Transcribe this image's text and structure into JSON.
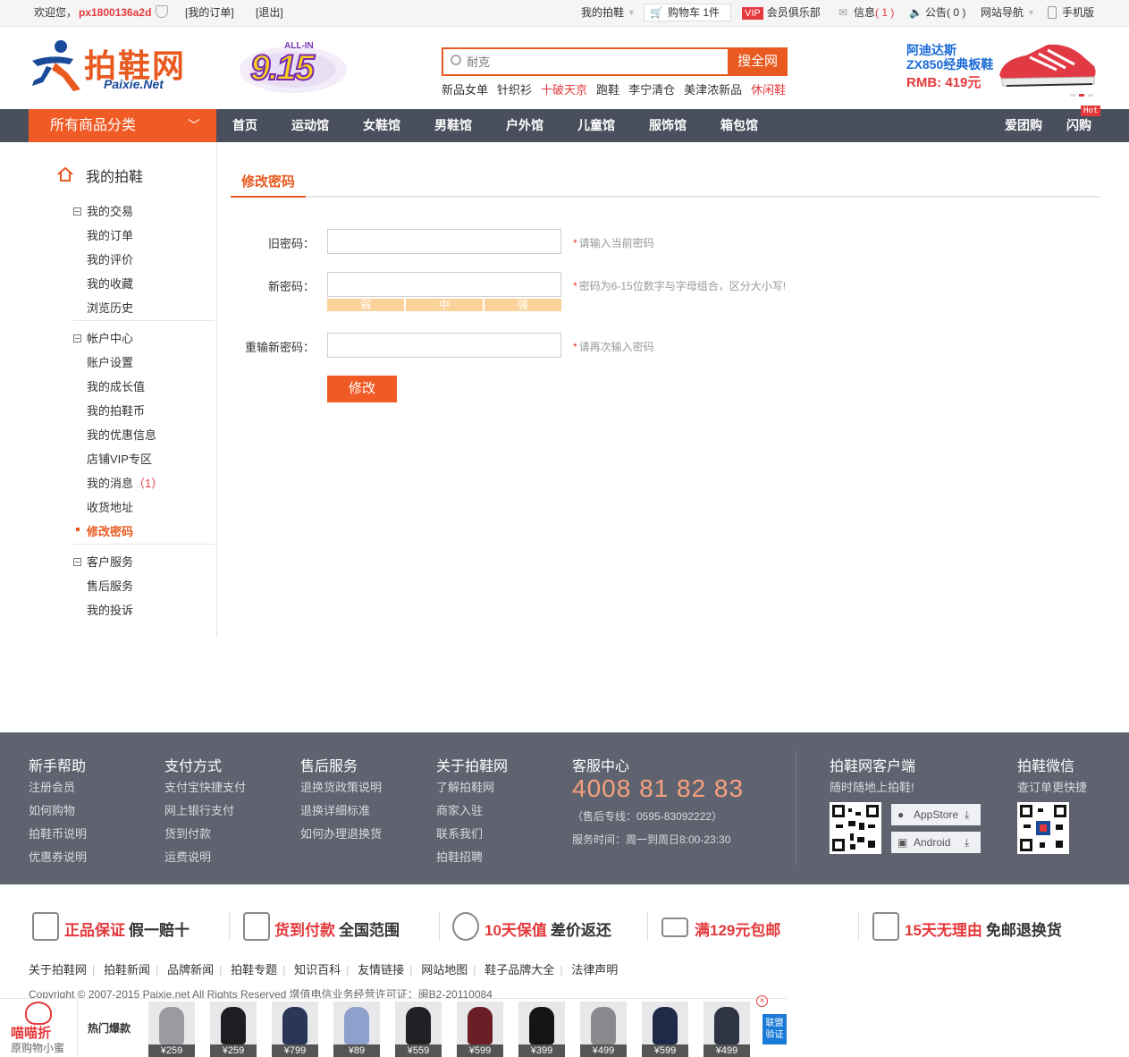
{
  "topbar": {
    "welcome": "欢迎您，",
    "username": "px1800136a2d",
    "my_orders": "[我的订单]",
    "logout": "[退出]",
    "my_paixie": "我的拍鞋",
    "cart": "购物车 1件",
    "vip_badge": "VIP",
    "club": "会员俱乐部",
    "messages_label": "信息",
    "messages_count": "( 1 )",
    "notice_label": "公告",
    "notice_count": "( 0 )",
    "site_nav": "网站导航",
    "mobile": "手机版"
  },
  "header": {
    "logo_text": "拍鞋网",
    "logo_sub": "Paixie.Net",
    "badge_top": "ALL-IN",
    "badge_main": "9.15",
    "search_placeholder": "耐克",
    "search_button": "搜全网",
    "hotwords": [
      "新品女单",
      "针织衫",
      "十破天京",
      "跑鞋",
      "李宁清仓",
      "美津浓新品",
      "休闲鞋"
    ],
    "ad_line1": "阿迪达斯",
    "ad_line2": "ZX850经典板鞋",
    "ad_price": "RMB: 419元"
  },
  "nav": {
    "all_categories": "所有商品分类",
    "items": [
      "首页",
      "运动馆",
      "女鞋馆",
      "男鞋馆",
      "户外馆",
      "儿童馆",
      "服饰馆",
      "箱包馆"
    ],
    "right_items": [
      "爱团购",
      "闪购"
    ],
    "hot_badge": "Hot"
  },
  "sidebar": {
    "title": "我的拍鞋",
    "groups": [
      {
        "label": "我的交易",
        "items": [
          "我的订单",
          "我的评价",
          "我的收藏",
          "浏览历史"
        ]
      },
      {
        "label": "帐户中心",
        "items": [
          "账户设置",
          "我的成长值",
          "我的拍鞋币",
          "我的优惠信息",
          "店铺VIP专区",
          "我的消息",
          "收货地址",
          "修改密码"
        ]
      },
      {
        "label": "客户服务",
        "items": [
          "售后服务",
          "我的投诉"
        ]
      }
    ],
    "message_count": "（1）"
  },
  "form": {
    "tab": "修改密码",
    "old_label": "旧密码：",
    "old_hint": "请输入当前密码",
    "new_label": "新密码：",
    "new_hint": "密码为6-15位数字与字母组合，区分大小写!",
    "strength": [
      "弱",
      "中",
      "强"
    ],
    "strength_level": "weak",
    "confirm_label": "重输新密码：",
    "confirm_hint": "请再次输入密码",
    "submit": "修改"
  },
  "footer": {
    "cols": [
      {
        "title": "新手帮助",
        "items": [
          "注册会员",
          "如何购物",
          "拍鞋币说明",
          "优惠券说明"
        ]
      },
      {
        "title": "支付方式",
        "items": [
          "支付宝快捷支付",
          "网上银行支付",
          "货到付款",
          "运费说明"
        ]
      },
      {
        "title": "售后服务",
        "items": [
          "退换货政策说明",
          "退换详细标准",
          "如何办理退换货"
        ]
      },
      {
        "title": "关于拍鞋网",
        "items": [
          "了解拍鞋网",
          "商家入驻",
          "联系我们",
          "拍鞋招聘"
        ]
      }
    ],
    "service_title": "客服中心",
    "tel": "4008 81 82 83",
    "aftersale_tel": "（售后专线：0595-83092222）",
    "service_time": "服务时间：周一到周日8:00-23:30",
    "app_title": "拍鞋网客户端",
    "app_sub": "随时随地上拍鞋!",
    "appstore": "AppStore",
    "android": "Android",
    "wechat_title": "拍鞋微信",
    "wechat_sub": "查订单更快捷"
  },
  "promises": [
    {
      "red": "正品保证",
      "black": "假一赔十"
    },
    {
      "red": "货到付款",
      "black": "全国范围"
    },
    {
      "red": "10天保值",
      "black": "差价返还"
    },
    {
      "red": "满129元包邮",
      "black": ""
    },
    {
      "red": "15天无理由",
      "black": "免邮退换货"
    }
  ],
  "links": [
    "关于拍鞋网",
    "拍鞋新闻",
    "品牌新闻",
    "拍鞋专题",
    "知识百科",
    "友情链接",
    "网站地图",
    "鞋子品牌大全",
    "法律声明"
  ],
  "copyright": "Copyright © 2007-2015 Paixie.net All Rights Reserved 增值电信业务经营许可证：闽B2-20110084",
  "strip": {
    "brand": "喵喵折",
    "brand_sub": "原购物小蜜",
    "label": "热门爆款",
    "prices": [
      "¥259",
      "¥259",
      "¥799",
      "¥89",
      "¥559",
      "¥599",
      "¥399",
      "¥499",
      "¥599",
      "¥499"
    ],
    "badge": "联盟验证",
    "close": "×"
  },
  "colors": {
    "accent": "#f05a24",
    "nav_bg": "#4a4f5d",
    "footer_bg": "#5f6370",
    "red": "#e4393c"
  }
}
